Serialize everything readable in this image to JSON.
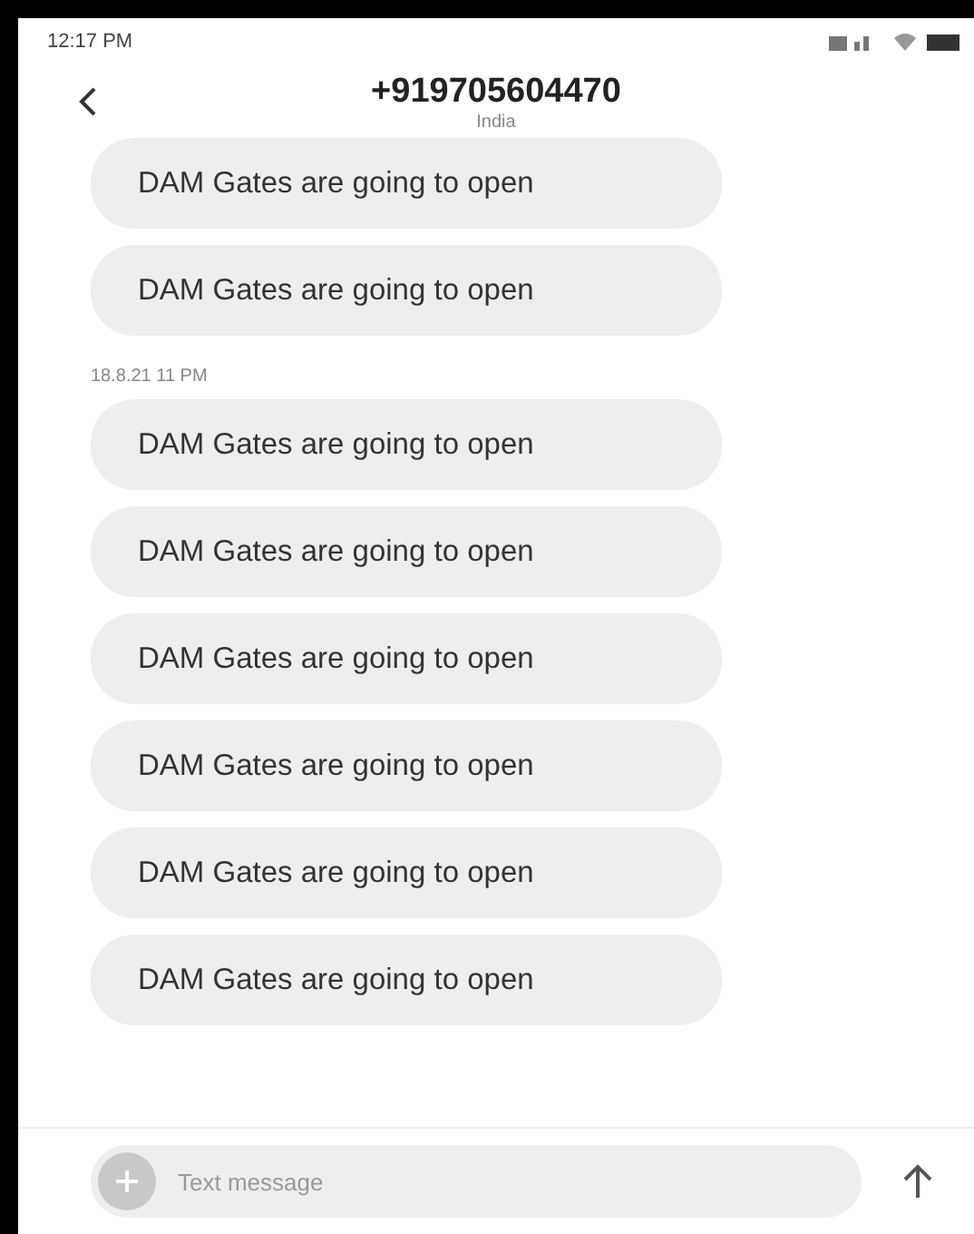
{
  "status_bar": {
    "time": "12:17 PM"
  },
  "header": {
    "title": "+919705604470",
    "subtitle": "India"
  },
  "messages": [
    {
      "kind": "bubble",
      "text": "DAM Gates are going to open"
    },
    {
      "kind": "bubble",
      "text": "DAM Gates are going to open"
    },
    {
      "kind": "date",
      "text": "18.8.21 11 PM"
    },
    {
      "kind": "bubble",
      "text": "DAM Gates are going to open"
    },
    {
      "kind": "bubble",
      "text": "DAM Gates are going to open"
    },
    {
      "kind": "bubble",
      "text": "DAM Gates are going to open"
    },
    {
      "kind": "bubble",
      "text": "DAM Gates are going to open"
    },
    {
      "kind": "bubble",
      "text": "DAM Gates are going to open"
    },
    {
      "kind": "bubble",
      "text": "DAM Gates are going to open"
    }
  ],
  "composer": {
    "placeholder": "Text message"
  }
}
